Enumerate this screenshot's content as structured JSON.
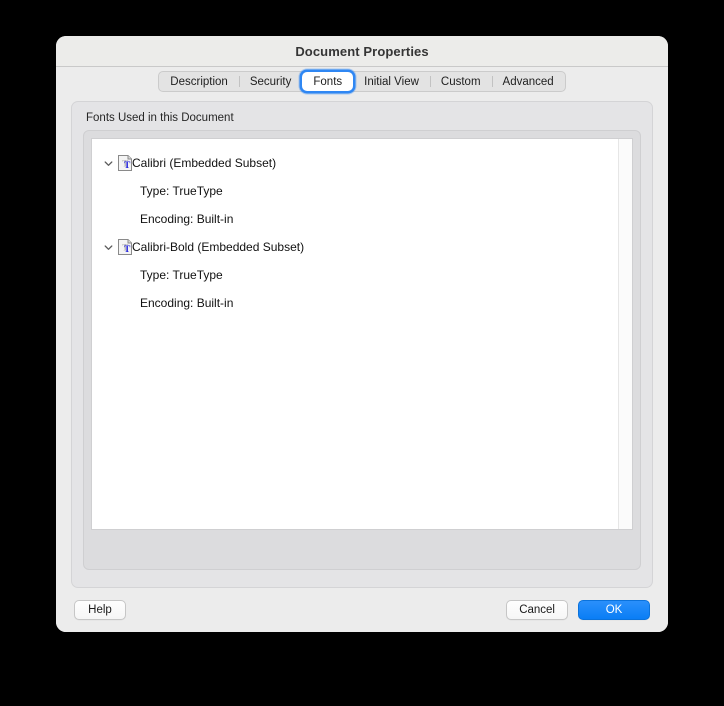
{
  "window": {
    "title": "Document Properties"
  },
  "tabs": [
    {
      "label": "Description",
      "selected": false,
      "name": "tab-description"
    },
    {
      "label": "Security",
      "selected": false,
      "name": "tab-security"
    },
    {
      "label": "Fonts",
      "selected": true,
      "name": "tab-fonts"
    },
    {
      "label": "Initial View",
      "selected": false,
      "name": "tab-initial-view"
    },
    {
      "label": "Custom",
      "selected": false,
      "name": "tab-custom"
    },
    {
      "label": "Advanced",
      "selected": false,
      "name": "tab-advanced"
    }
  ],
  "fonts_panel": {
    "group_label": "Fonts Used in this Document",
    "entries": [
      {
        "name": "Calibri (Embedded Subset)",
        "expanded": true,
        "icon": "truetype-font-icon",
        "details": [
          "Type: TrueType",
          "Encoding: Built-in"
        ]
      },
      {
        "name": "Calibri-Bold (Embedded Subset)",
        "expanded": true,
        "icon": "truetype-font-icon",
        "details": [
          "Type: TrueType",
          "Encoding: Built-in"
        ]
      }
    ]
  },
  "footer": {
    "help_label": "Help",
    "cancel_label": "Cancel",
    "ok_label": "OK"
  },
  "colors": {
    "accent_blue": "#0a7ef5",
    "focus_ring": "#2f87f3",
    "window_bg": "#ececec",
    "panel_bg": "#e4e4e6",
    "group_bg": "#dcdcde",
    "list_bg": "#ffffff",
    "icon_blue": "#2222dd"
  }
}
